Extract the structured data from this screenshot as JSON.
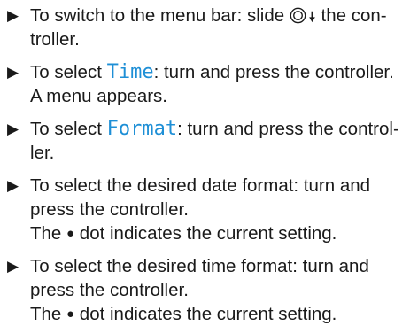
{
  "steps": [
    {
      "line1_a": "To switch to the menu bar: slide",
      "line1_b": "the con-",
      "line2": "troller.",
      "icon": "controller-slide-down-icon"
    },
    {
      "line1_a": "To select",
      "keyword": "Time",
      "line1_b": ": turn and press the controller.",
      "line2": "A menu appears."
    },
    {
      "line1_a": "To select",
      "keyword": "Format",
      "line1_b": ": turn and press the control-",
      "line2": "ler."
    },
    {
      "line1": "To select the desired date format: turn and",
      "line2": "press the controller.",
      "line3_a": "The",
      "line3_b": "dot indicates the current setting."
    },
    {
      "line1": "To select the desired time format: turn and",
      "line2": "press the controller.",
      "line3_a": "The",
      "line3_b": "dot indicates the current setting."
    }
  ],
  "glyphs": {
    "bullet": "▶",
    "dot": "●"
  },
  "colors": {
    "keyword": "#1e8fd6",
    "text": "#1a1a1a"
  }
}
